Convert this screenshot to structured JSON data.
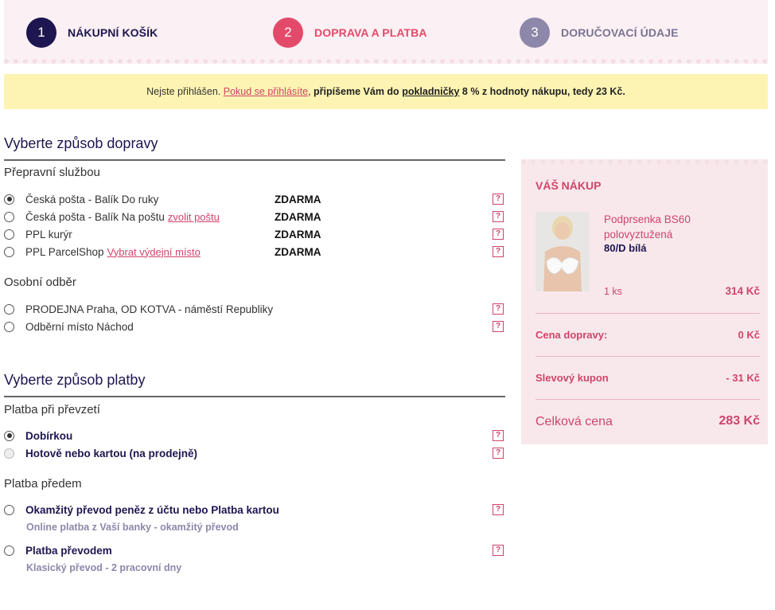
{
  "steps": [
    {
      "num": "1",
      "label": "NÁKUPNÍ KOŠÍK"
    },
    {
      "num": "2",
      "label": "DOPRAVA A PLATBA"
    },
    {
      "num": "3",
      "label": "DORUČOVACÍ ÚDAJE"
    }
  ],
  "notice": {
    "text_before": "Nejste přihlášen.",
    "link": "Pokud se přihlásíte",
    "bold_part1": "připíšeme Vám do",
    "bold_underlined": "pokladničky",
    "text_after": "8 % z hodnoty nákupu, tedy 23 Kč."
  },
  "shipping": {
    "title": "Vyberte způsob dopravy",
    "group1_title": "Přepravní službou",
    "options": [
      {
        "label": "Česká pošta - Balík Do ruky",
        "link": "",
        "price": "ZDARMA",
        "checked": true
      },
      {
        "label": "Česká pošta - Balík Na poštu",
        "link": "zvolit poštu",
        "price": "ZDARMA",
        "checked": false
      },
      {
        "label": "PPL kurýr",
        "link": "",
        "price": "ZDARMA",
        "checked": false
      },
      {
        "label": "PPL ParcelShop",
        "link": "Vybrat výdejní místo",
        "price": "ZDARMA",
        "checked": false
      }
    ],
    "group2_title": "Osobní odběr",
    "pickup": [
      {
        "label": "PRODEJNA Praha, OD KOTVA - náměstí Republiky"
      },
      {
        "label": "Odběrní místo Náchod"
      }
    ],
    "help": "?"
  },
  "payment": {
    "title": "Vyberte způsob platby",
    "group1_title": "Platba při převzetí",
    "on_delivery": [
      {
        "label": "Dobírkou",
        "checked": true,
        "disabled": false
      },
      {
        "label": "Hotově nebo kartou (na prodejně)",
        "checked": false,
        "disabled": true
      }
    ],
    "group2_title": "Platba předem",
    "prepaid": [
      {
        "label": "Okamžitý převod peněz z účtu nebo Platba kartou",
        "note": "Online platba z Vaší banky - okamžitý převod"
      },
      {
        "label": "Platba převodem",
        "note": "Klasický převod - 2 pracovní dny"
      }
    ]
  },
  "cart": {
    "title": "VÁŠ NÁKUP",
    "product_name": "Podprsenka BS60 polovyztužená",
    "product_variant": "80/D bílá",
    "quantity": "1 ks",
    "price": "314 Kč",
    "shipping_label": "Cena dopravy:",
    "shipping_value": "0 Kč",
    "coupon_label": "Slevový kupon",
    "coupon_value": "- 31 Kč",
    "total_label": "Celková cena",
    "total_value": "283 Kč"
  },
  "colors": {
    "navy": "#1d1650",
    "pink": "#e34a6a",
    "muted": "#8d87aa",
    "notice_bg": "#fdf4b3",
    "cart_bg": "#f8e8ec"
  }
}
